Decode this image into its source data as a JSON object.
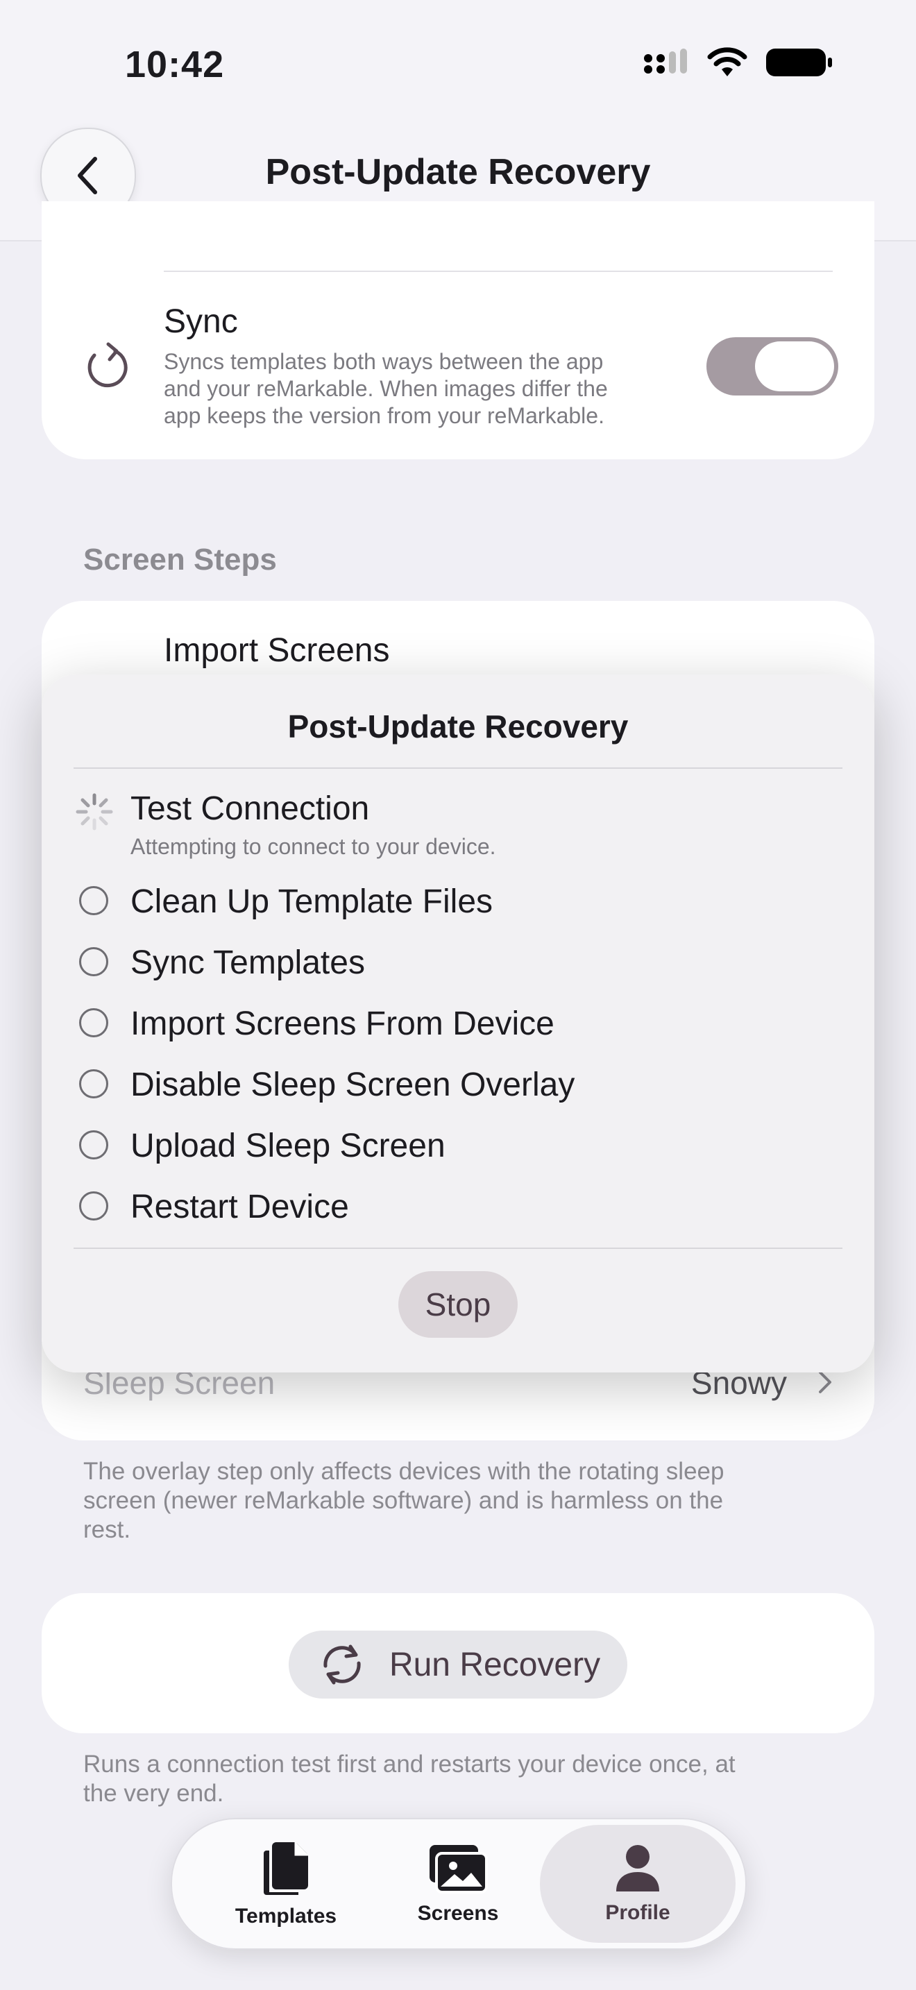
{
  "status_bar": {
    "time": "10:42"
  },
  "nav": {
    "title": "Post-Update Recovery"
  },
  "sync_row": {
    "title": "Sync",
    "description_lines": [
      "Syncs templates both ways between the app",
      "and your reMarkable. When images differ the",
      "app keeps the version from your reMarkable."
    ],
    "toggle_on": true
  },
  "screen_steps": {
    "header": "Screen Steps",
    "import_row_title": "Import Screens",
    "sleep_screen_label": "Sleep Screen",
    "sleep_screen_value": "Snowy",
    "footnote_lines": [
      "The overlay step only affects devices with the rotating sleep",
      "screen (newer reMarkable software) and is harmless on the",
      "rest."
    ]
  },
  "run": {
    "button_label": "Run Recovery",
    "footnote_lines": [
      "Runs a connection test first and restarts your device once, at",
      "the very end."
    ]
  },
  "modal": {
    "title": "Post-Update Recovery",
    "steps": [
      {
        "label": "Test Connection",
        "subtitle": "Attempting to connect to your device.",
        "state": "in-progress"
      },
      {
        "label": "Clean Up Template Files",
        "state": "pending"
      },
      {
        "label": "Sync Templates",
        "state": "pending"
      },
      {
        "label": "Import Screens From Device",
        "state": "pending"
      },
      {
        "label": "Disable Sleep Screen Overlay",
        "state": "pending"
      },
      {
        "label": "Upload Sleep Screen",
        "state": "pending"
      },
      {
        "label": "Restart Device",
        "state": "pending"
      }
    ],
    "stop_label": "Stop"
  },
  "tabbar": {
    "tabs": [
      {
        "label": "Templates",
        "icon": "documents-icon"
      },
      {
        "label": "Screens",
        "icon": "photos-icon"
      },
      {
        "label": "Profile",
        "icon": "person-icon",
        "active": true
      }
    ]
  },
  "colors": {
    "accent": "#4a3c47",
    "toggle_track": "#a59ba2",
    "background": "#f0eff5"
  }
}
